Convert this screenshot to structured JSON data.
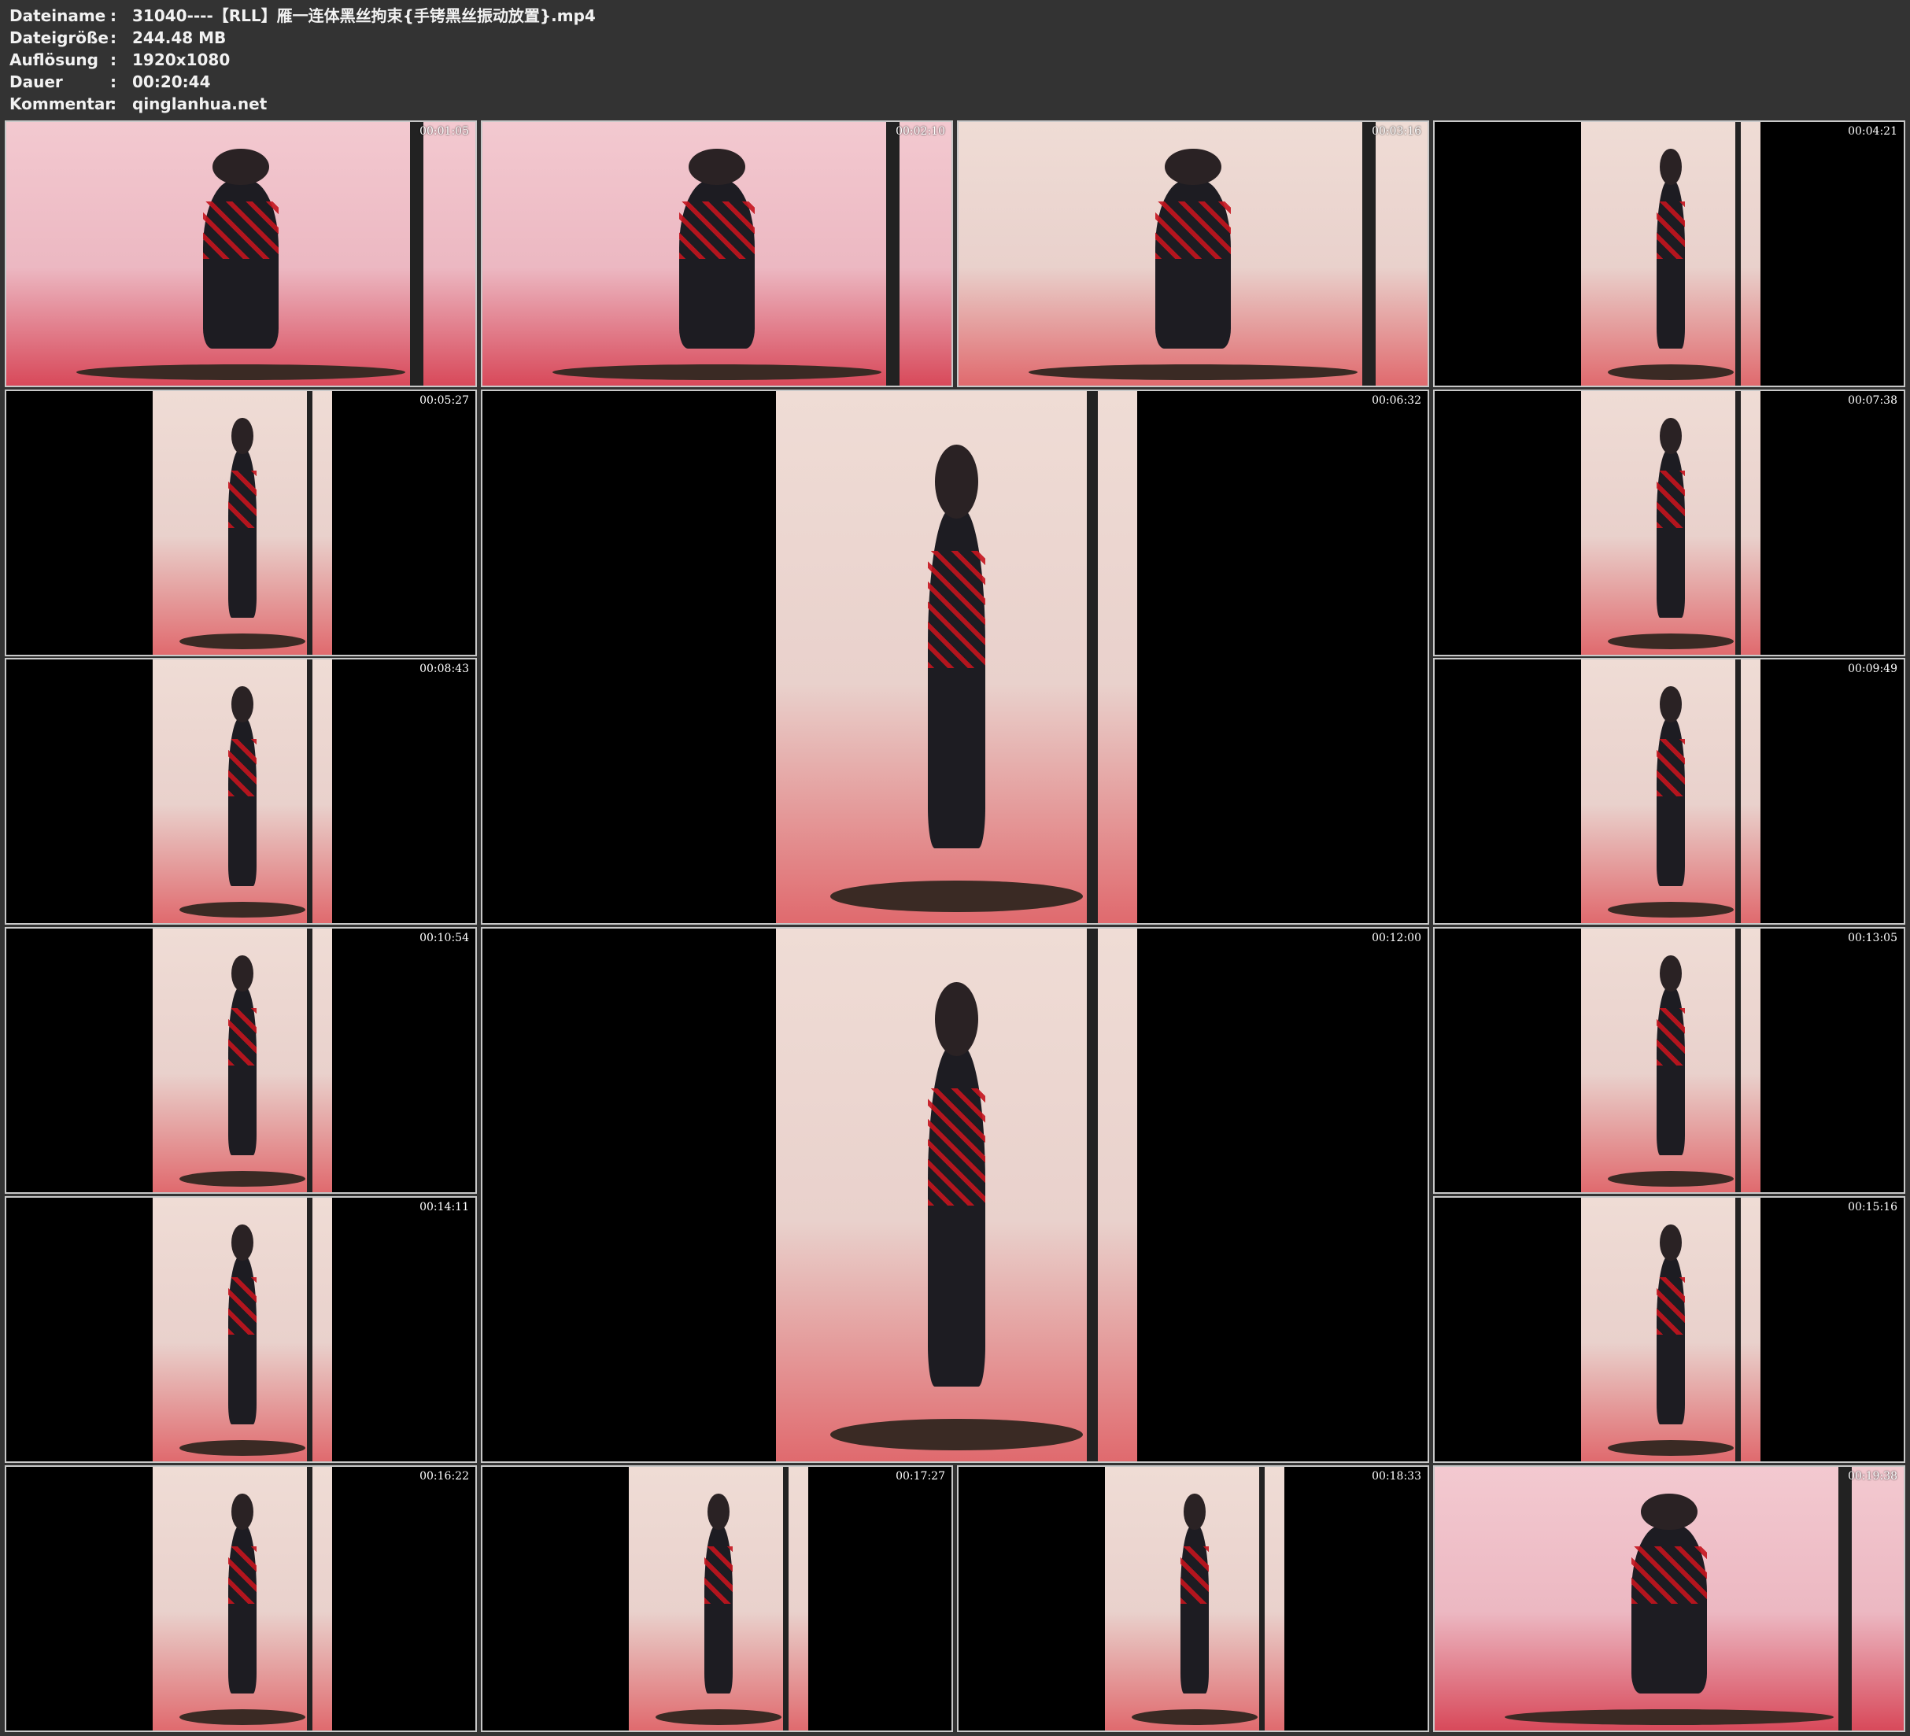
{
  "header": {
    "rows": [
      {
        "label": "Dateiname",
        "value": "31040----【RLL】雁一连体黑丝拘束{手铐黑丝振动放置}.mp4"
      },
      {
        "label": "Dateigröße",
        "value": "244.48 MB"
      },
      {
        "label": "Auflösung",
        "value": "1920x1080"
      },
      {
        "label": "Dauer",
        "value": "00:20:44"
      },
      {
        "label": "Kommentar",
        "value": "qinglanhua.net"
      }
    ],
    "separator": ":"
  },
  "thumbnails": [
    {
      "time": "00:01:05",
      "style": "wide"
    },
    {
      "time": "00:02:10",
      "style": "wide"
    },
    {
      "time": "00:03:16",
      "style": "wide"
    },
    {
      "time": "00:04:21",
      "style": "portrait"
    },
    {
      "time": "00:05:27",
      "style": "portrait"
    },
    {
      "time": "00:06:32",
      "style": "portrait-large"
    },
    {
      "time": "00:07:38",
      "style": "portrait"
    },
    {
      "time": "00:08:43",
      "style": "portrait"
    },
    {
      "time": "00:09:49",
      "style": "portrait"
    },
    {
      "time": "00:10:54",
      "style": "portrait"
    },
    {
      "time": "00:12:00",
      "style": "portrait-large"
    },
    {
      "time": "00:13:05",
      "style": "portrait"
    },
    {
      "time": "00:14:11",
      "style": "portrait"
    },
    {
      "time": "00:15:16",
      "style": "portrait"
    },
    {
      "time": "00:16:22",
      "style": "portrait"
    },
    {
      "time": "00:17:27",
      "style": "portrait"
    },
    {
      "time": "00:18:33",
      "style": "portrait"
    },
    {
      "time": "00:19:38",
      "style": "wide"
    }
  ]
}
